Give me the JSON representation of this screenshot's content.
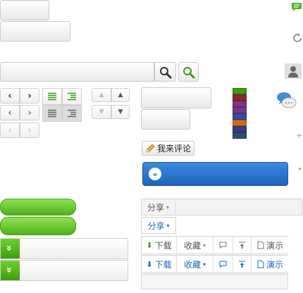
{
  "comment_button": {
    "label": "我来评论"
  },
  "share_bar": {
    "label": "分享",
    "arrow": "▾"
  },
  "share_button": {
    "label": "分享",
    "arrow": "▾"
  },
  "toolbar_gray": {
    "download": "下载",
    "favorite": "收藏",
    "present": "演示",
    "arrow": "▾"
  },
  "toolbar_blue": {
    "download": "下载",
    "favorite": "收藏",
    "present": "演示",
    "arrow": "▾"
  },
  "icons": {
    "comment": "comment-icon",
    "refresh": "refresh-icon",
    "user": "user-icon",
    "chat": "chat-bubbles-icon",
    "search": "search-icon",
    "pencil": "pencil-icon",
    "expand": "chevron-double-down-icon"
  },
  "colors": {
    "green": "#55b72a",
    "blue": "#1f6fc7",
    "blue_text": "#1a66b8",
    "swatches": [
      "#3a9a1c",
      "#8b2a2a",
      "#8d2f7a",
      "#6a3a9a",
      "#3a4aa0",
      "#d06a12",
      "#3a3a8a",
      "#2f4f7a"
    ]
  }
}
